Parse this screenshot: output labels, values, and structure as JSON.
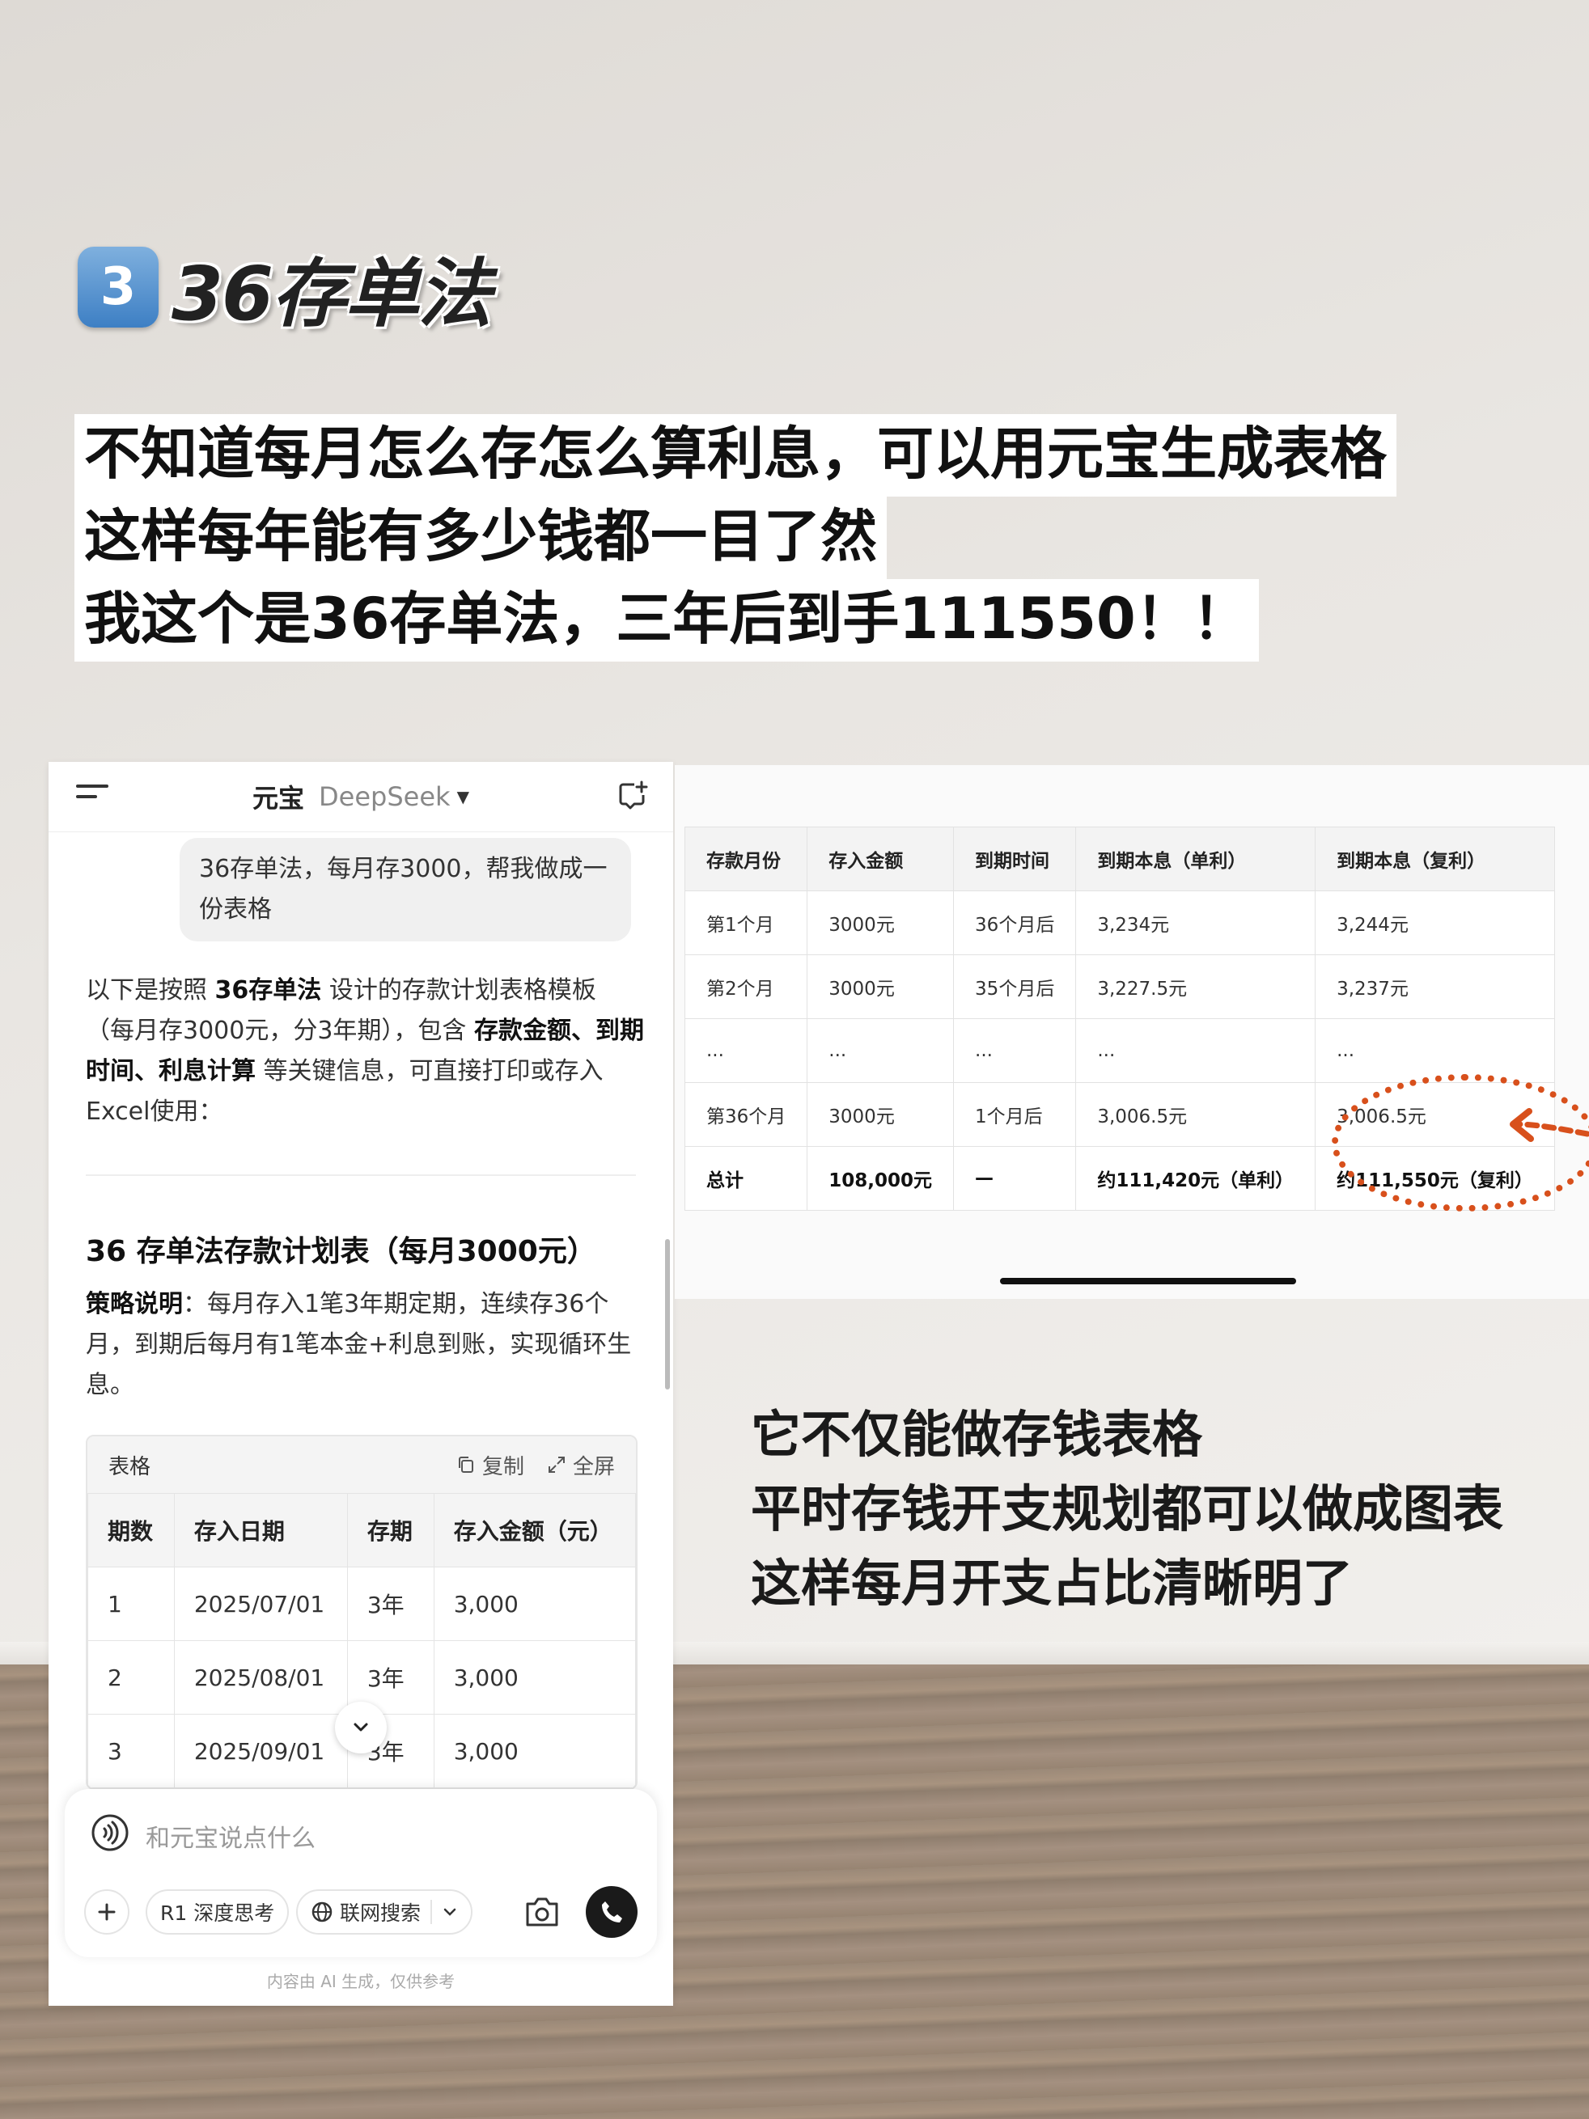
{
  "title": {
    "badge": "3",
    "text": "36存单法"
  },
  "intro": [
    "不知道每月怎么存怎么算利息，可以用元宝生成表格",
    "这样每年能有多少钱都一目了然",
    "我这个是36存单法，三年后到手111550！！"
  ],
  "app": {
    "name": "元宝",
    "model": "DeepSeek",
    "user_message": "36存单法，每月存3000，帮我做成一份表格",
    "ai_intro": {
      "p1": "以下是按照 ",
      "b1": "36存单法",
      "p2": " 设计的存款计划表格模板（每月存3000元，分3年期），包含 ",
      "b2": "存款金额、到期时间、利息计算",
      "p3": " 等关键信息，可直接打印或存入Excel使用："
    },
    "section_title": "36 存单法存款计划表（每月3000元）",
    "strategy_label": "策略说明",
    "strategy_text": "：每月存入1笔3年期定期，连续存36个月，到期后每月有1笔本金+利息到账，实现循环生息。",
    "table_label": "表格",
    "copy_label": "复制",
    "fullscreen_label": "全屏",
    "table": {
      "headers": [
        "期数",
        "存入日期",
        "存期",
        "存入金额（元）"
      ],
      "rows": [
        [
          "1",
          "2025/07/01",
          "3年",
          "3,000"
        ],
        [
          "2",
          "2025/08/01",
          "3年",
          "3,000"
        ],
        [
          "3",
          "2025/09/01",
          "3年",
          "3,000"
        ]
      ]
    },
    "input_placeholder": "和元宝说点什么",
    "chip_deep_think": "R1 深度思考",
    "chip_web_search": "联网搜索",
    "disclaimer": "内容由 AI 生成，仅供参考"
  },
  "screenshot2": {
    "headers": [
      "存款月份",
      "存入金额",
      "到期时间",
      "到期本息（单利）",
      "到期本息（复利）"
    ],
    "rows": [
      [
        "第1个月",
        "3000元",
        "36个月后",
        "3,234元",
        "3,244元"
      ],
      [
        "第2个月",
        "3000元",
        "35个月后",
        "3,227.5元",
        "3,237元"
      ],
      [
        "...",
        "...",
        "...",
        "...",
        "..."
      ],
      [
        "第36个月",
        "3000元",
        "1个月后",
        "3,006.5元",
        "3,006.5元"
      ]
    ],
    "total": [
      "总计",
      "108,000元",
      "—",
      "约111,420元（单利）",
      "约111,550元（复利）"
    ]
  },
  "caption": [
    "它不仅能做存钱表格",
    "平时存钱开支规划都可以做成图表",
    "这样每月开支占比清晰明了"
  ],
  "colors": {
    "annotation": "#d8501c",
    "badge": "#3d7fc4"
  }
}
